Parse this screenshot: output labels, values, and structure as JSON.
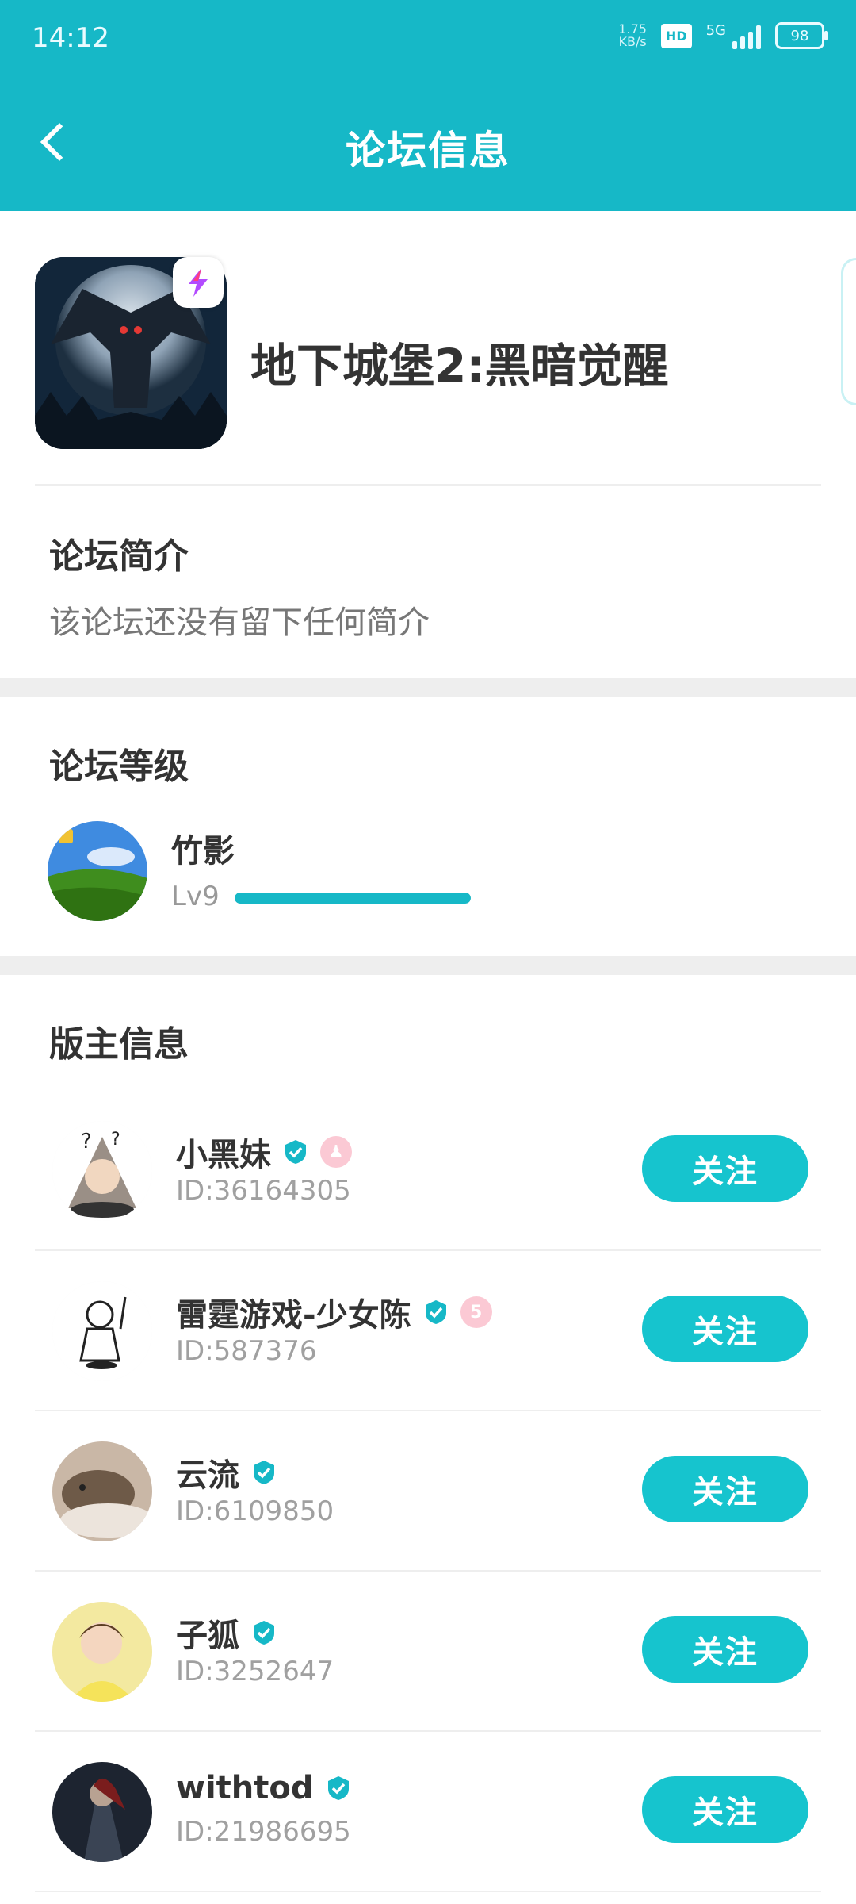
{
  "status_bar": {
    "time": "14:12",
    "net_speed_value": "1.75",
    "net_speed_unit": "KB/s",
    "hd": "HD",
    "network": "5G",
    "battery": "98"
  },
  "app_bar": {
    "title": "论坛信息"
  },
  "forum": {
    "name": "地下城堡2:黑暗觉醒"
  },
  "intro": {
    "title": "论坛简介",
    "text": "该论坛还没有留下任何简介"
  },
  "level": {
    "title": "论坛等级",
    "user_name": "竹影",
    "level": "Lv9",
    "progress": 1.0
  },
  "moderators": {
    "title": "版主信息",
    "follow_label": "关注",
    "items": [
      {
        "name": "小黑妹",
        "id": "ID:36164305"
      },
      {
        "name": "雷霆游戏-少女陈",
        "id": "ID:587376"
      },
      {
        "name": "云流",
        "id": "ID:6109850"
      },
      {
        "name": "子狐",
        "id": "ID:3252647"
      },
      {
        "name": "withtod",
        "id": "ID:21986695"
      }
    ]
  },
  "colors": {
    "accent": "#16B8C7",
    "button": "#16C4CE",
    "pink_badge": "#FBC9D4"
  }
}
